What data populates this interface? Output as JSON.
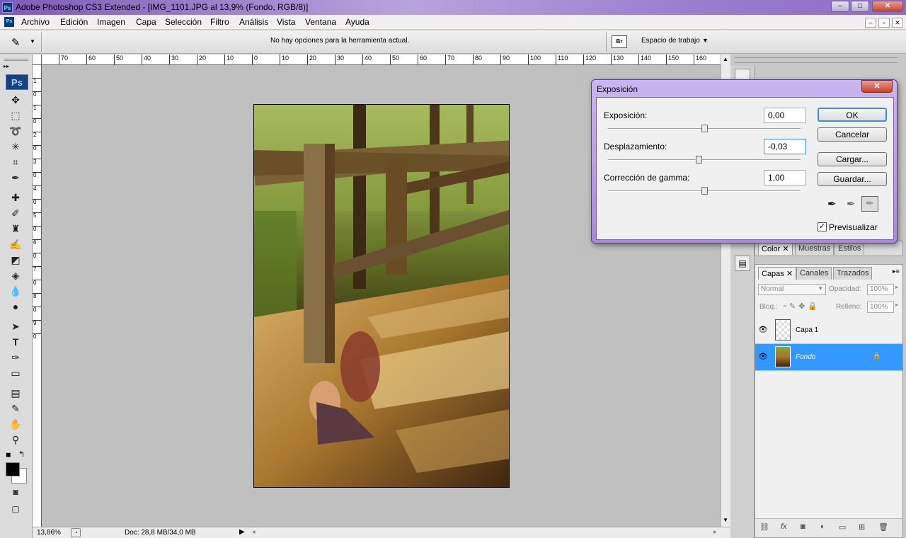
{
  "window": {
    "title": "Adobe Photoshop CS3 Extended - [IMG_1101.JPG al 13,9% (Fondo, RGB/8)]",
    "min": "–",
    "max": "□",
    "close": "✕"
  },
  "menu": {
    "items": [
      "Archivo",
      "Edición",
      "Imagen",
      "Capa",
      "Selección",
      "Filtro",
      "Análisis",
      "Vista",
      "Ventana",
      "Ayuda"
    ],
    "mdi": [
      "–",
      "▫",
      "✕"
    ]
  },
  "options": {
    "message": "No hay opciones para la herramienta actual.",
    "workspace": "Espacio de trabajo",
    "bridge_label": "Br"
  },
  "ruler": {
    "top": [
      "70",
      "60",
      "50",
      "40",
      "30",
      "20",
      "10",
      "0",
      "10",
      "20",
      "30",
      "40",
      "50",
      "60",
      "70",
      "80",
      "90",
      "100",
      "110",
      "120",
      "130",
      "140",
      "150",
      "160"
    ],
    "left": [
      "1",
      "0",
      "1",
      "0",
      "2",
      "0",
      "3",
      "0",
      "4",
      "0",
      "5",
      "0",
      "6",
      "0",
      "7",
      "0",
      "8",
      "0",
      "9",
      "0"
    ]
  },
  "status": {
    "zoom": "13,86%",
    "doc": "Doc: 28,8 MB/34,0 MB"
  },
  "toolbox": {
    "logo": "Ps"
  },
  "dialog": {
    "title": "Exposición",
    "close": "✕",
    "fields": [
      {
        "label": "Exposición:",
        "value": "0,00",
        "slider": 0.5
      },
      {
        "label": "Desplazamiento:",
        "value": "-0,03",
        "slider": 0.47
      },
      {
        "label": "Corrección de gamma:",
        "value": "1,00",
        "slider": 0.5
      }
    ],
    "buttons": {
      "ok": "OK",
      "cancel": "Cancelar",
      "load": "Cargar...",
      "save": "Guardar..."
    },
    "preview": "Previsualizar",
    "preview_checked": true
  },
  "panels": {
    "color_tabs": [
      "Color ✕",
      "Muestras",
      "Estilos"
    ],
    "layers_tabs": [
      "Capas ✕",
      "Canales",
      "Trazados"
    ],
    "blend": "Normal",
    "opacity_label": "Opacidad:",
    "opacity": "100%",
    "lock_label": "Bloq.:",
    "fill_label": "Relleno:",
    "fill": "100%",
    "layers": [
      {
        "name": "Capa 1",
        "selected": false
      },
      {
        "name": "Fondo",
        "selected": true
      }
    ]
  },
  "colors": {
    "selection": "#3399ff",
    "titlebar": "#9a7fcf",
    "dialog_frame": "#a78ad9"
  }
}
